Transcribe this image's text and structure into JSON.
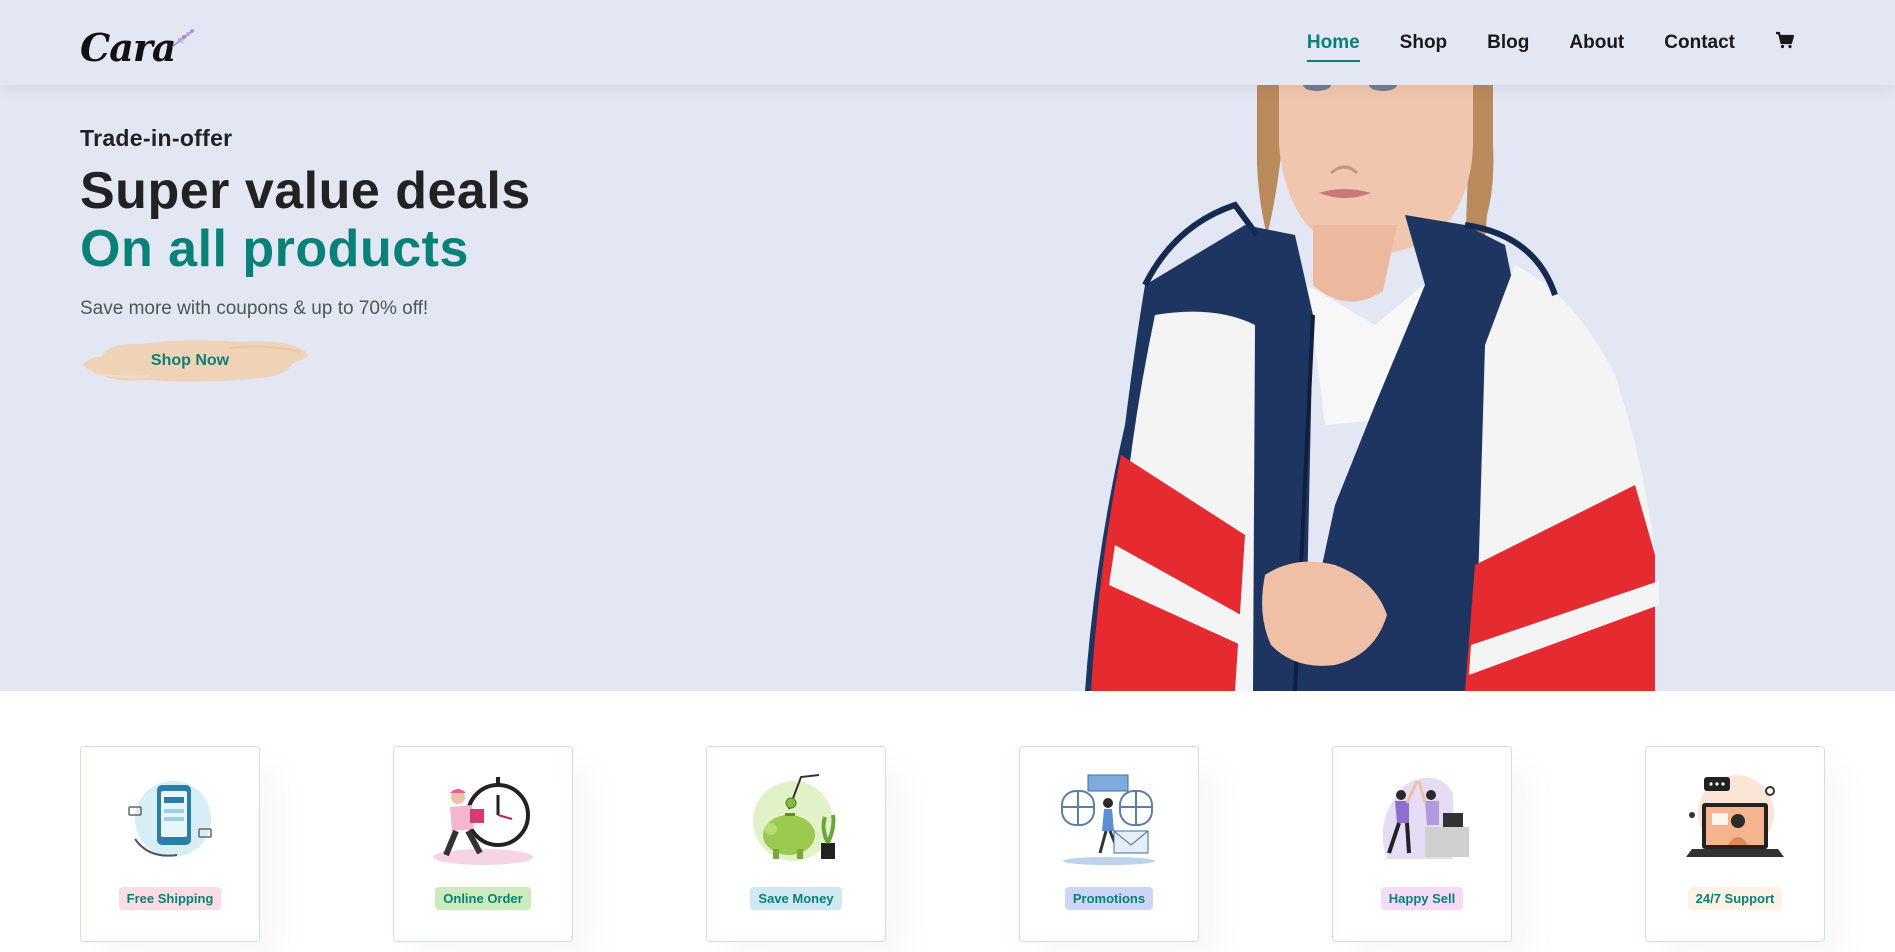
{
  "header": {
    "logo_text": "Cara",
    "nav": [
      {
        "label": "Home",
        "active": true
      },
      {
        "label": "Shop",
        "active": false
      },
      {
        "label": "Blog",
        "active": false
      },
      {
        "label": "About",
        "active": false
      },
      {
        "label": "Contact",
        "active": false
      }
    ],
    "cart_icon": "cart-icon"
  },
  "hero": {
    "kicker": "Trade-in-offer",
    "title_line1": "Super value deals",
    "title_line2": "On all products",
    "subtitle": "Save more with coupons & up to 70% off!",
    "cta_label": "Shop Now"
  },
  "features": [
    {
      "label": "Free Shipping",
      "badge_color": "#fddde4"
    },
    {
      "label": "Online Order",
      "badge_color": "#cdebbc"
    },
    {
      "label": "Save Money",
      "badge_color": "#d1e8f2"
    },
    {
      "label": "Promotions",
      "badge_color": "#cdd4f8"
    },
    {
      "label": "Happy Sell",
      "badge_color": "#f6dbf6"
    },
    {
      "label": "24/7 Support",
      "badge_color": "#fff2e5"
    }
  ],
  "colors": {
    "accent": "#088178",
    "hero_bg": "#e3e6f3",
    "brush": "#f0d2b6"
  }
}
